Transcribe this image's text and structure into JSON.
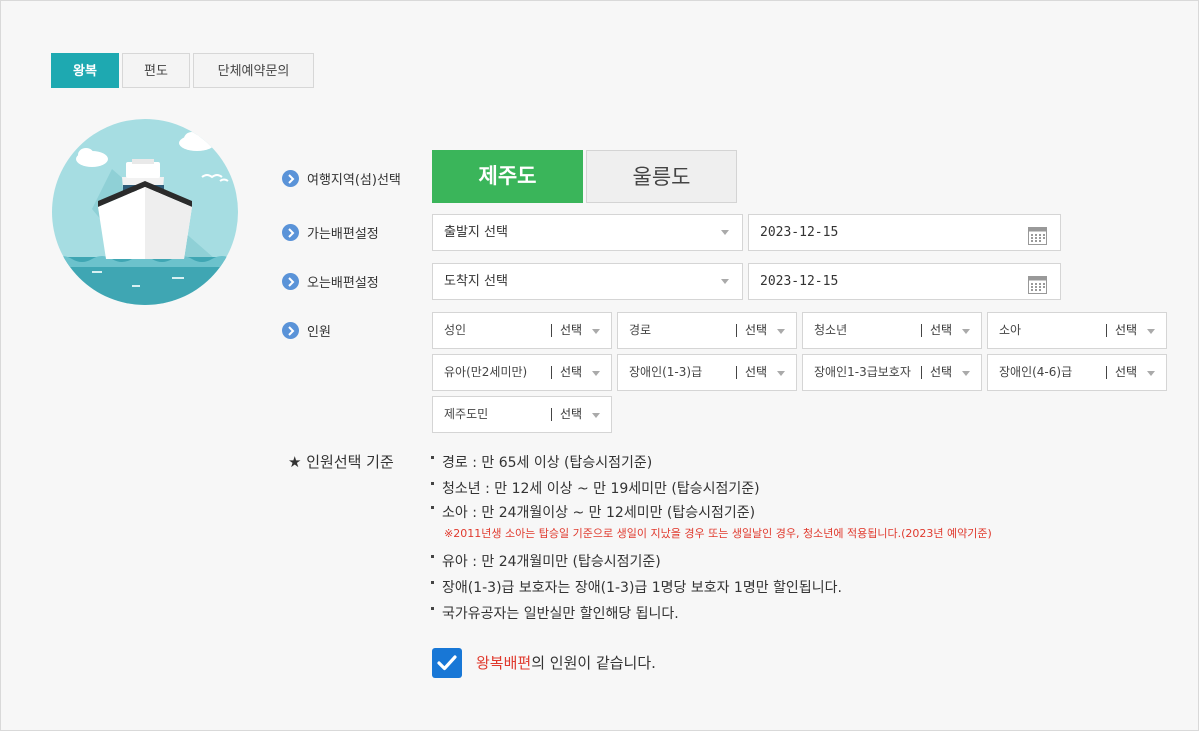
{
  "tabs": [
    {
      "label": "왕복",
      "active": true
    },
    {
      "label": "편도",
      "active": false
    },
    {
      "label": "단체예약문의",
      "active": false
    }
  ],
  "rows": {
    "region": "여행지역(섬)선택",
    "departure": "가는배편설정",
    "return": "오는배편설정",
    "passengers": "인원"
  },
  "islands": {
    "selected": "제주도",
    "other": "울릉도"
  },
  "departure": {
    "select_label": "출발지 선택",
    "date": "2023-12-15"
  },
  "return": {
    "select_label": "도착지 선택",
    "date": "2023-12-15"
  },
  "passengers": [
    {
      "label": "성인",
      "value": "선택"
    },
    {
      "label": "경로",
      "value": "선택"
    },
    {
      "label": "청소년",
      "value": "선택"
    },
    {
      "label": "소아",
      "value": "선택"
    },
    {
      "label": "유아(만2세미만)",
      "value": "선택"
    },
    {
      "label": "장애인(1-3)급",
      "value": "선택"
    },
    {
      "label": "장애인1-3급보호자",
      "value": "선택"
    },
    {
      "label": "장애인(4-6)급",
      "value": "선택"
    },
    {
      "label": "제주도민",
      "value": "선택"
    }
  ],
  "criteria": {
    "title": "★ 인원선택 기준",
    "rules": [
      "경로 : 만 65세 이상 (탑승시점기준)",
      "청소년 : 만 12세 이상 ~ 만 19세미만 (탑승시점기준)",
      "소아 : 만 24개월이상 ~ 만 12세미만 (탑승시점기준)",
      "유아 : 만 24개월미만 (탑승시점기준)",
      "장애(1-3)급 보호자는 장애(1-3)급 1명당 보호자 1명만 할인됩니다.",
      "국가유공자는 일반실만 할인해당 됩니다."
    ],
    "note": "※2011년생 소아는 탑승일 기준으로 생일이 지났을 경우 또는 생일날인 경우, 청소년에 적용됩니다.(2023년 예약기준)"
  },
  "same_passengers": {
    "highlight": "왕복배편",
    "rest": "의 인원이 같습니다.",
    "checked": true
  },
  "colors": {
    "accent": "#1ea9b1",
    "selected_island": "#3ab55a",
    "checkbox": "#1877d6",
    "note_red": "#e03a2e",
    "bullet_icon": "#5a93d8"
  }
}
